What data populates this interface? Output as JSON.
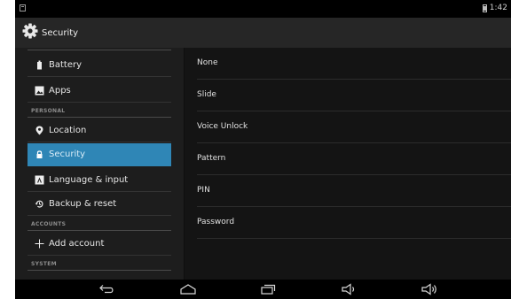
{
  "status_bar": {
    "time": "1:42"
  },
  "action_bar": {
    "title": "Security"
  },
  "sidebar": {
    "items": [
      {
        "label": "Battery",
        "icon": "battery-icon",
        "selected": false
      },
      {
        "label": "Apps",
        "icon": "apps-icon",
        "selected": false
      },
      {
        "label": "Location",
        "icon": "location-pin-icon",
        "selected": false
      },
      {
        "label": "Security",
        "icon": "lock-icon",
        "selected": true
      },
      {
        "label": "Language & input",
        "icon": "keyboard-icon",
        "selected": false
      },
      {
        "label": "Backup & reset",
        "icon": "backup-reset-icon",
        "selected": false
      },
      {
        "label": "Add account",
        "icon": "plus-icon",
        "selected": false
      }
    ],
    "headers": {
      "personal": "PERSONAL",
      "accounts": "ACCOUNTS",
      "system": "SYSTEM"
    }
  },
  "screen_lock_options": [
    "None",
    "Slide",
    "Voice Unlock",
    "Pattern",
    "PIN",
    "Password"
  ],
  "nav_bar": {
    "icons": [
      "back-icon",
      "home-icon",
      "recent-apps-icon",
      "volume-down-icon",
      "volume-up-icon"
    ]
  },
  "colors": {
    "accent": "#2f86b6",
    "background": "#141414",
    "sidebar": "#1d1d1d",
    "action_bar": "#262626"
  }
}
